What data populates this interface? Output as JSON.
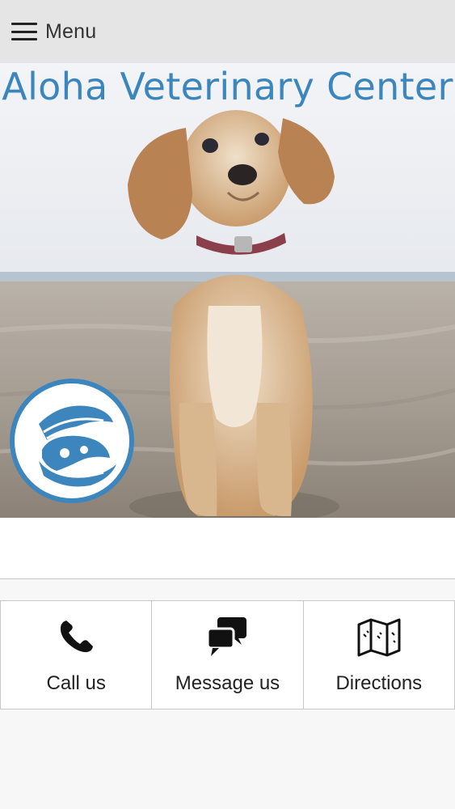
{
  "header": {
    "menu_label": "Menu"
  },
  "hero": {
    "title": "Aloha Veterinary Center"
  },
  "actions": [
    {
      "label": "Call us",
      "icon": "phone-icon"
    },
    {
      "label": "Message us",
      "icon": "chat-bubbles-icon"
    },
    {
      "label": "Directions",
      "icon": "map-icon"
    }
  ],
  "colors": {
    "accent": "#3b86bd",
    "header_bg": "#e5e5e5"
  }
}
